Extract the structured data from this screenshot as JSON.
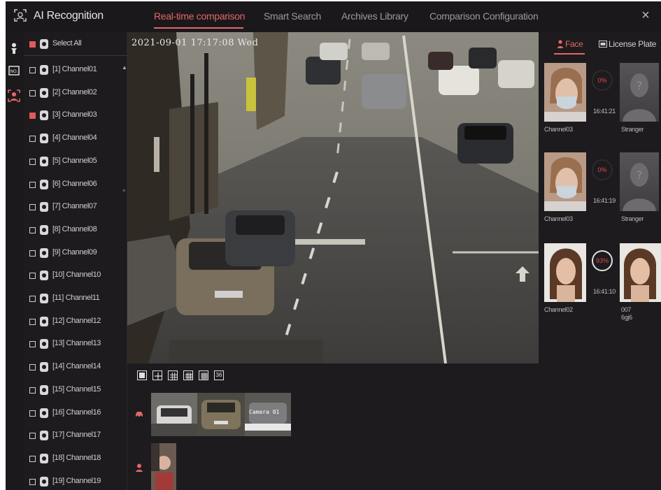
{
  "app": {
    "title": "AI Recognition"
  },
  "tabs": [
    {
      "label": "Real-time comparison",
      "active": true
    },
    {
      "label": "Smart Search",
      "active": false
    },
    {
      "label": "Archives Library",
      "active": false
    },
    {
      "label": "Comparison Configuration",
      "active": false
    }
  ],
  "close_label": "×",
  "rail_badge": "NO.",
  "channel_list": {
    "select_all": {
      "label": "Select All",
      "checked": true
    },
    "channels": [
      {
        "label": "[1] Channel01",
        "checked": false
      },
      {
        "label": "[2] Channel02",
        "checked": false
      },
      {
        "label": "[3] Channel03",
        "checked": true
      },
      {
        "label": "[4] Channel04",
        "checked": false
      },
      {
        "label": "[5] Channel05",
        "checked": false
      },
      {
        "label": "[6] Channel06",
        "checked": false
      },
      {
        "label": "[7] Channel07",
        "checked": false
      },
      {
        "label": "[8] Channel08",
        "checked": false
      },
      {
        "label": "[9] Channel09",
        "checked": false
      },
      {
        "label": "[10] Channel10",
        "checked": false
      },
      {
        "label": "[11] Channel11",
        "checked": false
      },
      {
        "label": "[12] Channel12",
        "checked": false
      },
      {
        "label": "[13] Channel13",
        "checked": false
      },
      {
        "label": "[14] Channel14",
        "checked": false
      },
      {
        "label": "[15] Channel15",
        "checked": false
      },
      {
        "label": "[16] Channel16",
        "checked": false
      },
      {
        "label": "[17] Channel17",
        "checked": false
      },
      {
        "label": "[18] Channel18",
        "checked": false
      },
      {
        "label": "[19] Channel19",
        "checked": false
      }
    ]
  },
  "video": {
    "osd": "2021-09-01 17:17:08 Wed"
  },
  "layout_buttons": [
    "1",
    "4",
    "9",
    "16",
    "25",
    "36"
  ],
  "snapshot_overlay": "Camera 01",
  "right_panel": {
    "tabs": {
      "face": "Face",
      "plate": "License Plate"
    },
    "matches": [
      {
        "channel": "Channel03",
        "score": "0%",
        "time": "16:41:21",
        "result": "Stranger",
        "result_sub": ""
      },
      {
        "channel": "Channel03",
        "score": "0%",
        "time": "16:41:19",
        "result": "Stranger",
        "result_sub": ""
      },
      {
        "channel": "Channel02",
        "score": "93%",
        "time": "16:41:10",
        "result": "007",
        "result_sub": "6gj6"
      }
    ]
  },
  "colors": {
    "accent": "#e46767",
    "background": "#1d1b1d",
    "checked": "#e05a5a"
  }
}
